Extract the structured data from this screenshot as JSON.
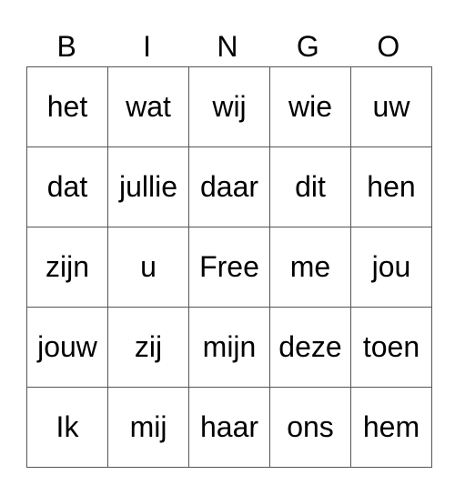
{
  "header": [
    "B",
    "I",
    "N",
    "G",
    "O"
  ],
  "rows": [
    [
      "het",
      "wat",
      "wij",
      "wie",
      "uw"
    ],
    [
      "dat",
      "jullie",
      "daar",
      "dit",
      "hen"
    ],
    [
      "zijn",
      "u",
      "Free",
      "me",
      "jou"
    ],
    [
      "jouw",
      "zij",
      "mijn",
      "deze",
      "toen"
    ],
    [
      "Ik",
      "mij",
      "haar",
      "ons",
      "hem"
    ]
  ]
}
